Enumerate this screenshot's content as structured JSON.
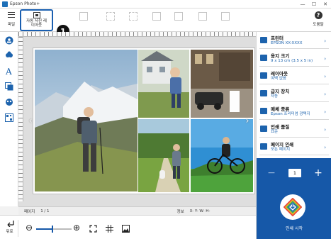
{
  "window": {
    "title": "Epson Photo+",
    "minimize": "—",
    "maximize": "☐",
    "close": "✕"
  },
  "toolbar": {
    "menu_label": "파일",
    "auto_layout_line1": "자동 사진 레",
    "auto_layout_line2": "이아웃",
    "callout_number": "1",
    "help_label": "도움말",
    "help_glyph": "?"
  },
  "canvas": {
    "prev_arrow": "‹",
    "next_arrow": "›",
    "photos": [
      {
        "name": "hiker-mountain-photo"
      },
      {
        "name": "child-house-photo"
      },
      {
        "name": "city-street-photo"
      },
      {
        "name": "park-path-photo"
      },
      {
        "name": "cyclist-photo"
      }
    ]
  },
  "status": {
    "page_label": "페이지",
    "page_value": "1 / 1",
    "info_label": "정보",
    "info_values": "X-  Y-  W-  H-"
  },
  "bottom": {
    "back_label": "뒤로",
    "zoom_out": "⊖",
    "zoom_in": "⊕",
    "zoom_level_percent": 45
  },
  "settings": [
    {
      "label": "프린터",
      "value": "EPSON XX-XXXX",
      "icon": "printer-icon"
    },
    {
      "label": "용지 크기",
      "value": "9 x 13 cm (3.5 x 5 in)",
      "icon": "paper-size-icon"
    },
    {
      "label": "레이아웃",
      "value": "여백 없음",
      "icon": "layout-icon"
    },
    {
      "label": "급지 장치",
      "value": "자동",
      "icon": "paper-source-icon"
    },
    {
      "label": "매체 종류",
      "value": "Epson 프리미엄 광택지",
      "icon": "media-type-icon"
    },
    {
      "label": "인쇄 품질",
      "value": "표준",
      "icon": "print-quality-icon"
    },
    {
      "label": "페이지 인쇄",
      "value": "모든 페이지",
      "icon": "page-print-icon"
    }
  ],
  "print": {
    "minus": "−",
    "plus": "+",
    "copies": "1",
    "button_label": "인쇄 시작"
  },
  "colors": {
    "accent": "#1658a8",
    "highlight": "#1a5fb0"
  }
}
